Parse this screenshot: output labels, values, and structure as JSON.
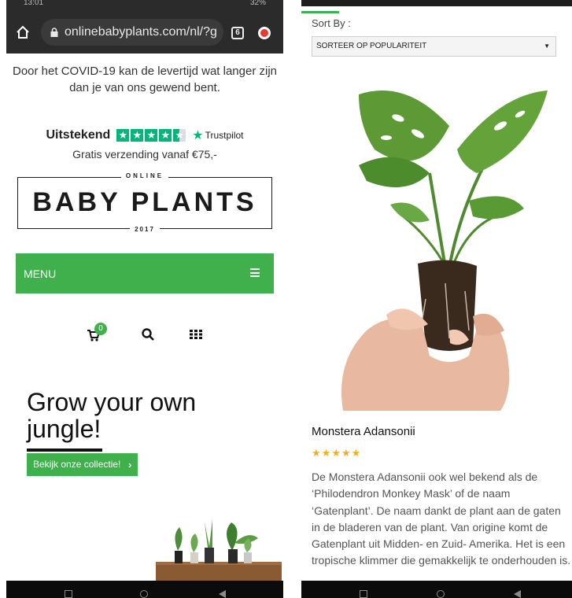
{
  "left": {
    "status": {
      "time": "13:01",
      "right": "32%"
    },
    "browser": {
      "url": "onlinebabyplants.com/nl/?g",
      "tab_count": "6"
    },
    "notice": {
      "line1": "Door het COVID-19 kan de levertijd wat langer zijn",
      "line2": "dan je van ons gewend bent."
    },
    "trustpilot": {
      "rating_text": "Uitstekend",
      "brand": "Trustpilot",
      "stars": 4.5
    },
    "shipping": "Gratis verzending vanaf €75,-",
    "logo": {
      "top": "ONLINE",
      "name": "BABY PLANTS",
      "year": "2017"
    },
    "menu": {
      "label": "MENU"
    },
    "cart": {
      "count": "0"
    },
    "hero": {
      "line1": "Grow your own",
      "line2": "jungle!"
    },
    "cta": {
      "label": "Bekijk onze collectie!"
    }
  },
  "right": {
    "sort": {
      "label": "Sort By :",
      "selected": "SORTEER OP POPULARITEIT"
    },
    "product": {
      "name": "Monstera Adansonii",
      "rating": 5,
      "description": "De Monstera Adansonii ook wel bekend als de ‘Philodendron Monkey Mask’ of de naam ‘Gatenplant’. De naam dankt de plant aan de gaten in de bladeren van de plant. Van origine komt de Gatenplant uit Midden- en Zuid- Amerika. Het is een tropische klimmer die gemakkelijk te onderhouden is."
    }
  },
  "colors": {
    "brand_green": "#3fb04b",
    "trustpilot_green": "#00b67a",
    "star_gold": "#f2b01e"
  }
}
